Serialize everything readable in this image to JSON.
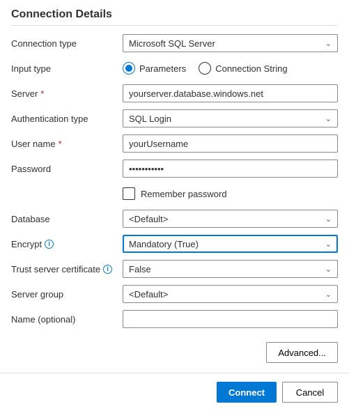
{
  "title": "Connection Details",
  "labels": {
    "connection_type": "Connection type",
    "input_type": "Input type",
    "server": "Server",
    "auth_type": "Authentication type",
    "user_name": "User name",
    "password": "Password",
    "remember": "Remember password",
    "database": "Database",
    "encrypt": "Encrypt",
    "trust_cert": "Trust server certificate",
    "server_group": "Server group",
    "name_optional": "Name (optional)"
  },
  "values": {
    "connection_type": "Microsoft SQL Server",
    "input_type_param": "Parameters",
    "input_type_connstr": "Connection String",
    "server": "yourserver.database.windows.net",
    "auth_type": "SQL Login",
    "user_name": "yourUsername",
    "password": "•••••••••••",
    "database": "<Default>",
    "encrypt": "Mandatory (True)",
    "trust_cert": "False",
    "server_group": "<Default>",
    "name_optional": ""
  },
  "buttons": {
    "advanced": "Advanced...",
    "connect": "Connect",
    "cancel": "Cancel"
  }
}
